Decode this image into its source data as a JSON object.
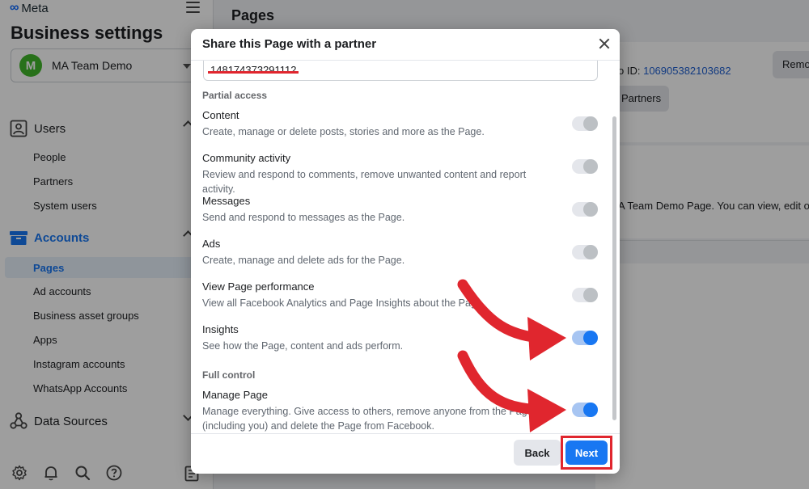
{
  "sidebar": {
    "brand": "Meta",
    "title": "Business settings",
    "business": {
      "initial": "M",
      "name": "MA Team Demo"
    },
    "users": {
      "label": "Users",
      "items": [
        "People",
        "Partners",
        "System users"
      ]
    },
    "accounts": {
      "label": "Accounts",
      "active_item": "Pages",
      "items": [
        "Ad accounts",
        "Business asset groups",
        "Apps",
        "Instagram accounts",
        "WhatsApp Accounts"
      ]
    },
    "data_sources": {
      "label": "Data Sources"
    },
    "bottom_icons": [
      "settings-icon",
      "bell-icon",
      "search-icon",
      "help-icon",
      "book-icon"
    ]
  },
  "main": {
    "title": "Pages",
    "id_prefix": "o ID:",
    "id_value": "106905382103682",
    "remove_label": "Remov",
    "partners_label": "Partners",
    "view_text": "A Team Demo Page. You can view, edit or de"
  },
  "modal": {
    "title": "Share this Page with a partner",
    "partner_id": "148174373291112",
    "partial_access_label": "Partial access",
    "full_control_label": "Full control",
    "permissions": [
      {
        "title": "Content",
        "desc": "Create, manage or delete posts, stories and more as the Page.",
        "enabled": false
      },
      {
        "title": "Community activity",
        "desc": "Review and respond to comments, remove unwanted content and report activity.",
        "enabled": false
      },
      {
        "title": "Messages",
        "desc": "Send and respond to messages as the Page.",
        "enabled": false
      },
      {
        "title": "Ads",
        "desc": "Create, manage and delete ads for the Page.",
        "enabled": false
      },
      {
        "title": "View Page performance",
        "desc": "View all Facebook Analytics and Page Insights about the Page.",
        "enabled": false
      },
      {
        "title": "Insights",
        "desc": "See how the Page, content and ads perform.",
        "enabled": true
      }
    ],
    "full_control": {
      "title": "Manage Page",
      "desc": "Manage everything. Give access to others, remove anyone from the Page (including you) and delete the Page from Facebook.",
      "enabled": true
    },
    "back_label": "Back",
    "next_label": "Next"
  },
  "colors": {
    "accent": "#1877f2",
    "annotation_red": "#e0262e",
    "toggle_off": "#bcc0c4"
  }
}
